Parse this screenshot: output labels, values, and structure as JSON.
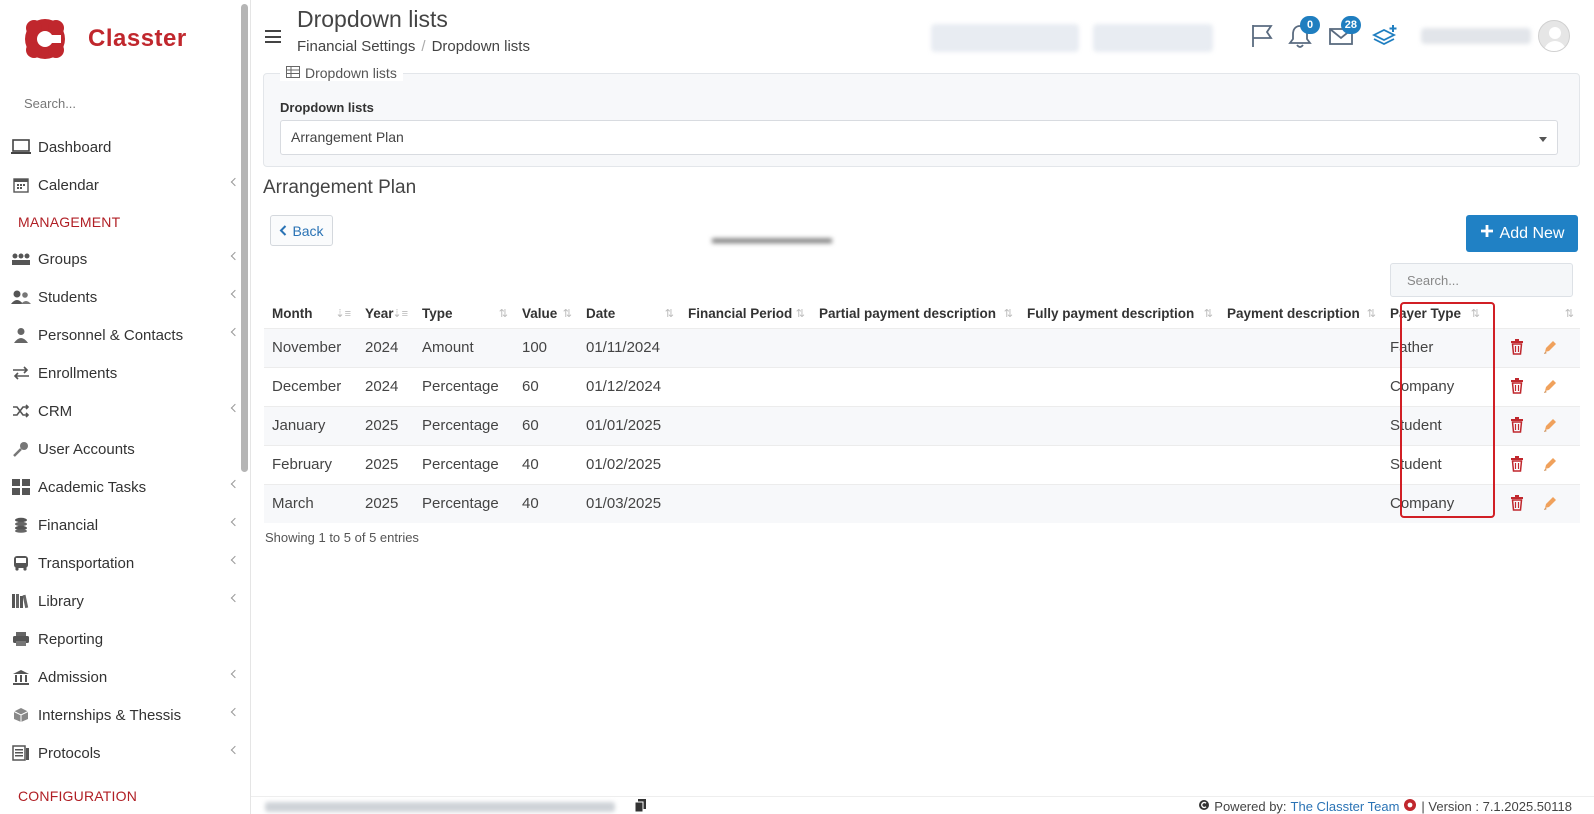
{
  "brand": {
    "name": "Classter",
    "color": "#c0272d"
  },
  "sidebar": {
    "search_placeholder": "Search...",
    "items_top": [
      {
        "label": "Dashboard",
        "icon": "laptop-icon",
        "has_children": false
      },
      {
        "label": "Calendar",
        "icon": "calendar-icon",
        "has_children": true
      }
    ],
    "section_management": "MANAGEMENT",
    "items_management": [
      {
        "label": "Groups",
        "icon": "groups-icon",
        "has_children": true
      },
      {
        "label": "Students",
        "icon": "students-icon",
        "has_children": true
      },
      {
        "label": "Personnel & Contacts",
        "icon": "person-icon",
        "has_children": true
      },
      {
        "label": "Enrollments",
        "icon": "exchange-icon",
        "has_children": false
      },
      {
        "label": "CRM",
        "icon": "shuffle-icon",
        "has_children": true
      },
      {
        "label": "User Accounts",
        "icon": "key-icon",
        "has_children": false
      },
      {
        "label": "Academic Tasks",
        "icon": "grid-icon",
        "has_children": true
      },
      {
        "label": "Financial",
        "icon": "coins-icon",
        "has_children": true
      },
      {
        "label": "Transportation",
        "icon": "bus-icon",
        "has_children": true
      },
      {
        "label": "Library",
        "icon": "books-icon",
        "has_children": true
      },
      {
        "label": "Reporting",
        "icon": "printer-icon",
        "has_children": false
      },
      {
        "label": "Admission",
        "icon": "institution-icon",
        "has_children": true
      },
      {
        "label": "Internships & Thessis",
        "icon": "box-icon",
        "has_children": true
      },
      {
        "label": "Protocols",
        "icon": "protocol-icon",
        "has_children": true
      }
    ],
    "section_configuration": "CONFIGURATION"
  },
  "header": {
    "title": "Dropdown lists",
    "breadcrumb": [
      "Financial Settings",
      "Dropdown lists"
    ],
    "notifications_count": "0",
    "messages_count": "28"
  },
  "filter": {
    "legend": "Dropdown lists",
    "label": "Dropdown lists",
    "selected": "Arrangement Plan"
  },
  "main": {
    "section_title": "Arrangement Plan",
    "back_label": "Back",
    "add_label": "Add New",
    "search_placeholder": "Search...",
    "showing": "Showing 1 to 5 of 5 entries"
  },
  "table": {
    "columns": [
      "Month",
      "Year",
      "Type",
      "Value",
      "Date",
      "Financial Period",
      "Partial payment description",
      "Fully payment description",
      "Payment description",
      "Payer Type"
    ],
    "rows": [
      [
        "November",
        "2024",
        "Amount",
        "100",
        "01/11/2024",
        "",
        "",
        "",
        "",
        "Father"
      ],
      [
        "December",
        "2024",
        "Percentage",
        "60",
        "01/12/2024",
        "",
        "",
        "",
        "",
        "Company"
      ],
      [
        "January",
        "2025",
        "Percentage",
        "60",
        "01/01/2025",
        "",
        "",
        "",
        "",
        "Student"
      ],
      [
        "February",
        "2025",
        "Percentage",
        "40",
        "01/02/2025",
        "",
        "",
        "",
        "",
        "Student"
      ],
      [
        "March",
        "2025",
        "Percentage",
        "40",
        "01/03/2025",
        "",
        "",
        "",
        "",
        "Company"
      ]
    ]
  },
  "footer": {
    "powered_by": "Powered by:",
    "team": "The Classter Team",
    "version": "| Version : 7.1.2025.50118"
  },
  "colors": {
    "accent": "#2081c5",
    "highlight": "#d11f25"
  }
}
